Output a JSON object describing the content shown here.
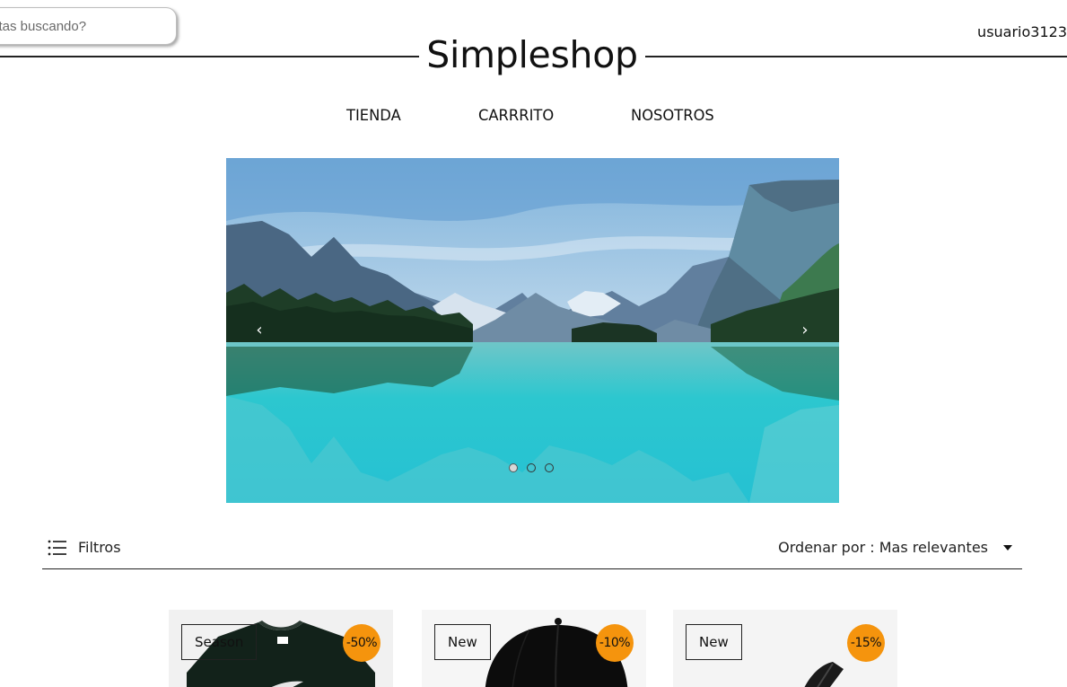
{
  "search": {
    "placeholder": "stas buscando?"
  },
  "header": {
    "brand": "Simpleshop",
    "username": "usuario3123"
  },
  "nav": {
    "items": [
      "TIENDA",
      "CARRRITO",
      "NOSOTROS"
    ]
  },
  "carousel": {
    "slide_count": 3,
    "active_slide": 1
  },
  "toolbar": {
    "filters_label": "Filtros",
    "sort_label": "Ordenar por : Mas relevantes"
  },
  "products": [
    {
      "tag": "Season",
      "discount": "-50%"
    },
    {
      "tag": "New",
      "discount": "-10%"
    },
    {
      "tag": "New",
      "discount": "-15%"
    }
  ],
  "colors": {
    "accent": "#f5940d",
    "text": "#111111",
    "rule": "#222222"
  }
}
